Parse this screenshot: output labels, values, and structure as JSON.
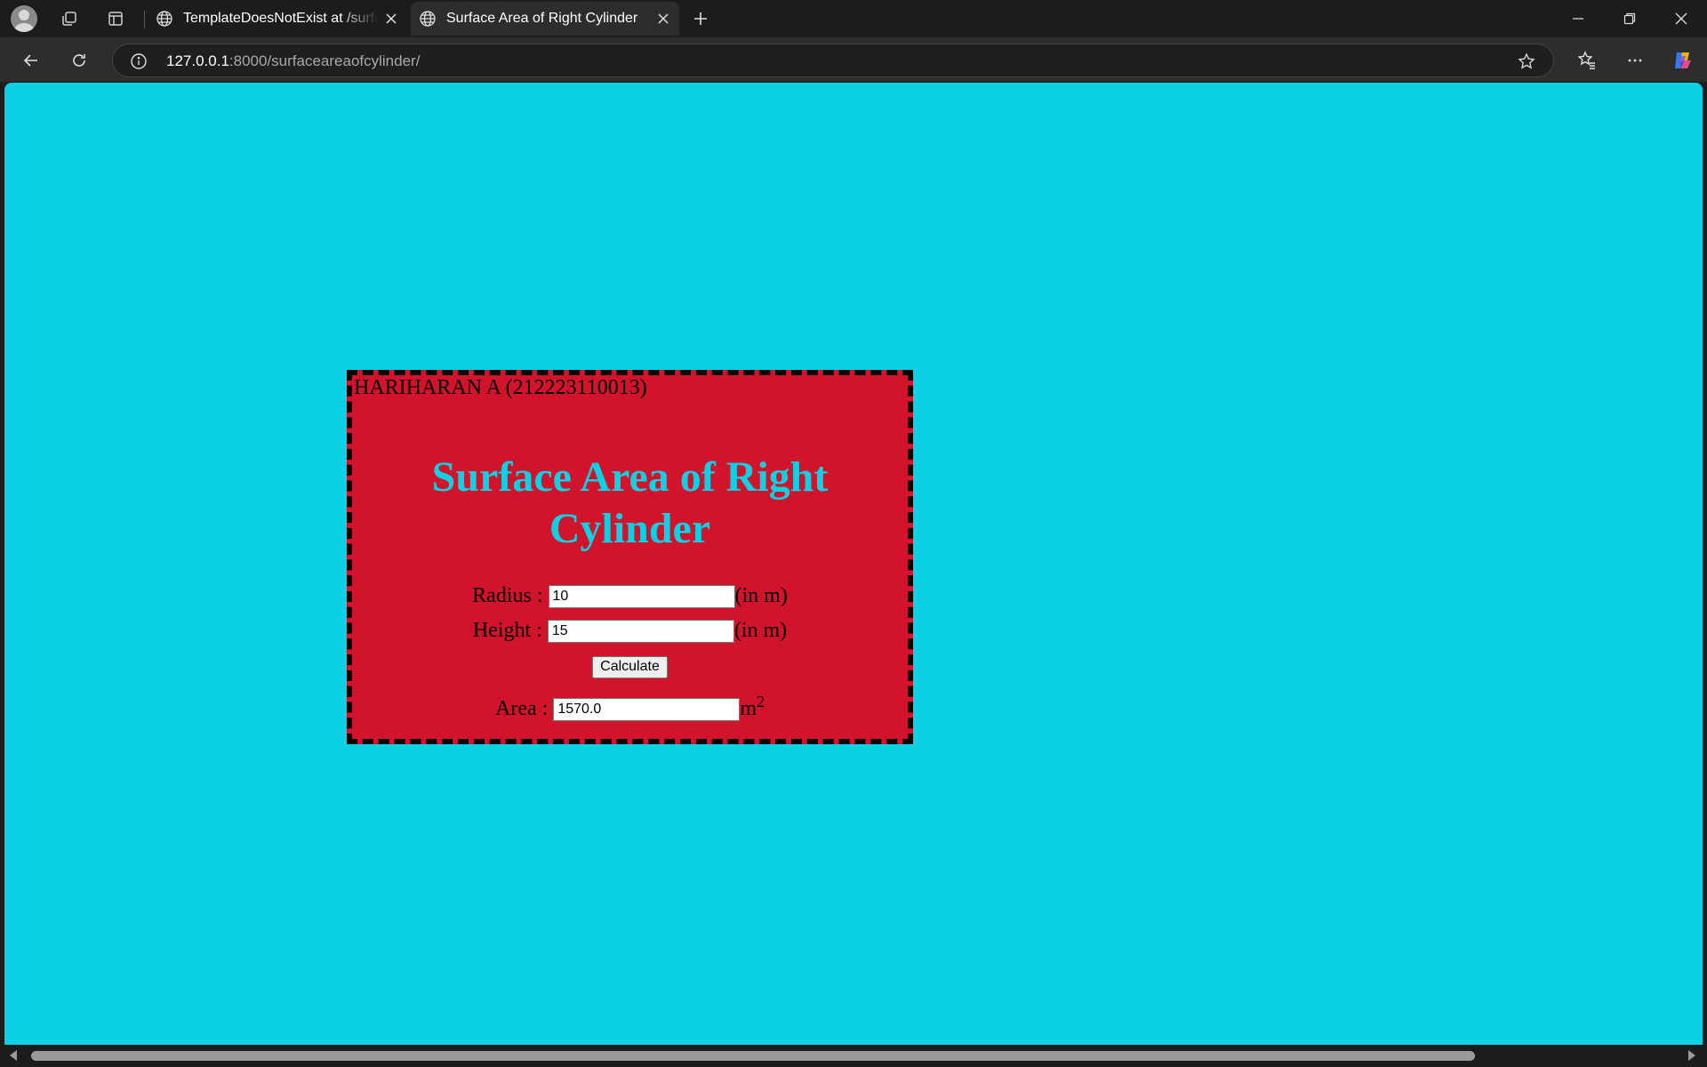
{
  "browser": {
    "tabs": [
      {
        "title": "TemplateDoesNotExist at /surfaceareaofcylinder/",
        "active": false
      },
      {
        "title": "Surface Area of Right Cylinder",
        "active": true
      }
    ],
    "address": {
      "host": "127.0.0.1",
      "path": ":8000/surfaceareaofcylinder/"
    }
  },
  "page": {
    "background_color": "#0cd1e4",
    "card_color": "#d1142b",
    "author": "HARIHARAN A (212223110013)",
    "heading": "Surface Area of Right Cylinder",
    "radius": {
      "label": "Radius :",
      "value": "10",
      "unit": "(in m)"
    },
    "height": {
      "label": "Height :",
      "value": "15",
      "unit": "(in m)"
    },
    "calculate_label": "Calculate",
    "area": {
      "label": "Area :",
      "value": "1570.0",
      "unit": "m",
      "unit_sup": "2"
    }
  }
}
